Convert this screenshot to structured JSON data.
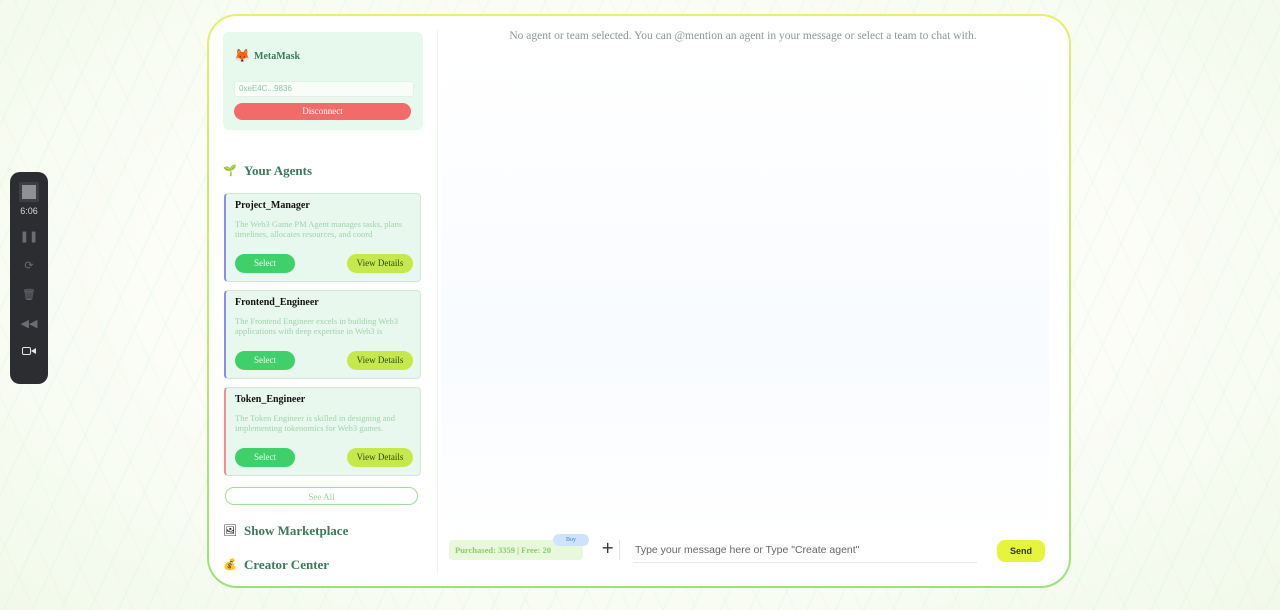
{
  "recorder": {
    "time": "6:06",
    "icons": [
      "stop-icon",
      "pause-icon",
      "restart-icon",
      "trash-icon",
      "rewind-icon",
      "camera-icon"
    ]
  },
  "wallet": {
    "name": "MetaMask",
    "address": "0xeE4C...9836",
    "disconnect_label": "Disconnect"
  },
  "sidebar": {
    "your_agents_label": "Your Agents",
    "see_all_label": "See All",
    "marketplace_label": "Show Marketplace",
    "creator_label": "Creator Center"
  },
  "agents": [
    {
      "name": "Project_Manager",
      "description": "The Web3 Game PM Agent manages tasks, plans timelines, allocates resources, and coord",
      "select_label": "Select",
      "details_label": "View Details",
      "accent": "#8c8cf0"
    },
    {
      "name": "Frontend_Engineer",
      "description": "The Frontend Engineer excels in building Web3 applications with deep expertise in Web3 is",
      "select_label": "Select",
      "details_label": "View Details",
      "accent": "#8c8cf0"
    },
    {
      "name": "Token_Engineer",
      "description": "The Token Engineer is skilled in designing and implementing tokenomics for Web3 games.",
      "select_label": "Select",
      "details_label": "View Details",
      "accent": "#f08c9a"
    }
  ],
  "chat": {
    "status": "No agent or team selected. You can @mention an agent in your message or select a team to chat with.",
    "credits": "Purchased: 3359 | Free: 20",
    "buy_label": "Buy",
    "input_placeholder": "Type your message here or Type \"Create agent\"",
    "send_label": "Send"
  },
  "colors": {
    "accent_green": "#3fd06a",
    "accent_lime": "#c5e84a",
    "danger": "#f26a6a",
    "send": "#e7f53a"
  }
}
